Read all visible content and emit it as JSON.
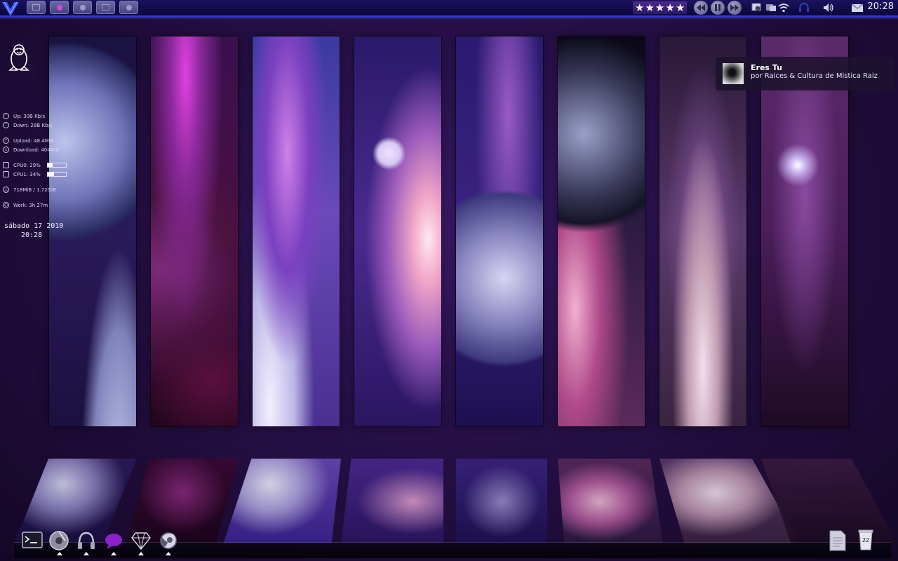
{
  "top_panel": {
    "quick_launch": [
      "home-button",
      "media-player-button",
      "settings-button",
      "window-button",
      "trash-button"
    ],
    "rating_stars": 5,
    "media_controls": [
      "previous-icon",
      "pause-icon",
      "next-icon"
    ],
    "tray": [
      "network-settings-icon",
      "display-icon",
      "wifi-icon",
      "headset-icon",
      "volume-icon",
      "mail-icon"
    ],
    "clock": "20:28"
  },
  "sysmon": {
    "up": "Up: 30B   Kb/s",
    "down": "Down: 28B   Kb/s",
    "upload": "Upload: 48.4MiB",
    "download": "Download: 404MiB",
    "cpu0": {
      "label": "CPU0: 29%",
      "percent": 29
    },
    "cpu1": {
      "label": "CPU1: 34%",
      "percent": 34
    },
    "memory": "718MiB / 1.72GiB",
    "work": "Work:  3h 27m",
    "date": "sábado 17 2010",
    "time": "20:28"
  },
  "notification": {
    "title": "Eres Tu",
    "subtitle": "por Raices & Cultura de Mistica Raiz"
  },
  "dock": {
    "left": [
      "terminal-icon",
      "disk-utility-icon",
      "music-player-icon",
      "chat-icon",
      "ruby-gem-icon",
      "firefox-icon"
    ],
    "right": [
      "document-icon",
      "trash-icon"
    ],
    "trash_badge": "22"
  },
  "colors": {
    "accent": "#2c3bd8",
    "background": "#261046",
    "panel_bg": "#120a45"
  }
}
